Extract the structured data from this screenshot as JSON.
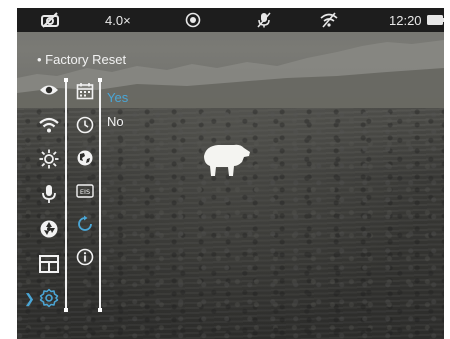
{
  "status_bar": {
    "camera_icon": "camera-off-icon",
    "zoom": "4.0×",
    "record_icon": "recording-mode-icon",
    "mic_icon": "mic-off-icon",
    "wifi_icon": "wifi-off-icon",
    "time": "12:20",
    "battery_icon": "battery-icon"
  },
  "menu": {
    "title": "• Factory Reset",
    "main_icons": [
      "eye-icon",
      "wifi-icon",
      "brightness-icon",
      "microphone-icon",
      "shutter-icon",
      "layout-icon",
      "settings-icon"
    ],
    "active_main": "settings-icon",
    "sub_icons": [
      "calendar-icon",
      "clock-icon",
      "globe-icon",
      "eis-icon",
      "reset-icon",
      "info-icon"
    ],
    "eis_label": "EIS",
    "active_sub": "reset-icon",
    "options": {
      "yes": "Yes",
      "no": "No"
    },
    "selected_option": "Yes"
  },
  "colors": {
    "accent": "#4aa6d6",
    "text": "#f2f2f2",
    "status_bg": "#1d1d1d"
  }
}
